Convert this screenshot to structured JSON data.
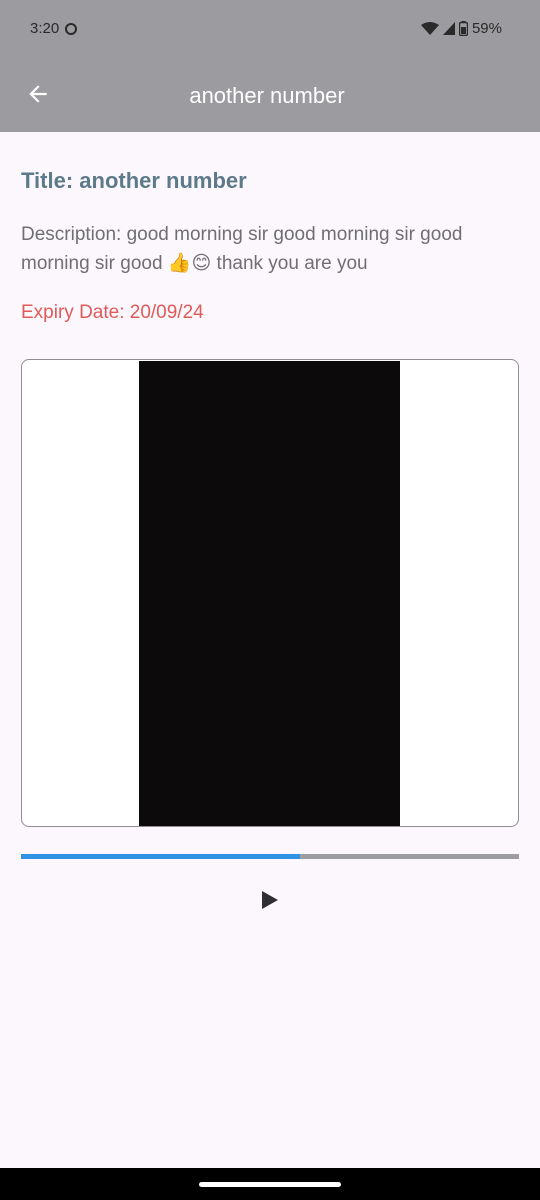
{
  "status_bar": {
    "time": "3:20",
    "battery": "59%"
  },
  "app_bar": {
    "title": "another number"
  },
  "detail": {
    "title": "Title: another number",
    "description": "Description: good morning sir good morning sir good morning sir good 👍😊 thank you are you",
    "expiry": "Expiry Date: 20/09/24"
  },
  "video": {
    "progress_fraction": 0.56
  },
  "colors": {
    "app_bar": "#9c9b9f",
    "background": "#fcf7fd",
    "title": "#5c7a8a",
    "description": "#6f6f73",
    "expiry": "#e05a59",
    "progress_fill": "#2f92e4",
    "progress_track": "#9d9ca0"
  },
  "icons": {
    "back": "arrow-back-icon",
    "play": "play-icon",
    "wifi": "wifi-icon",
    "signal": "signal-icon",
    "battery": "battery-icon",
    "notification": "notification-icon"
  }
}
